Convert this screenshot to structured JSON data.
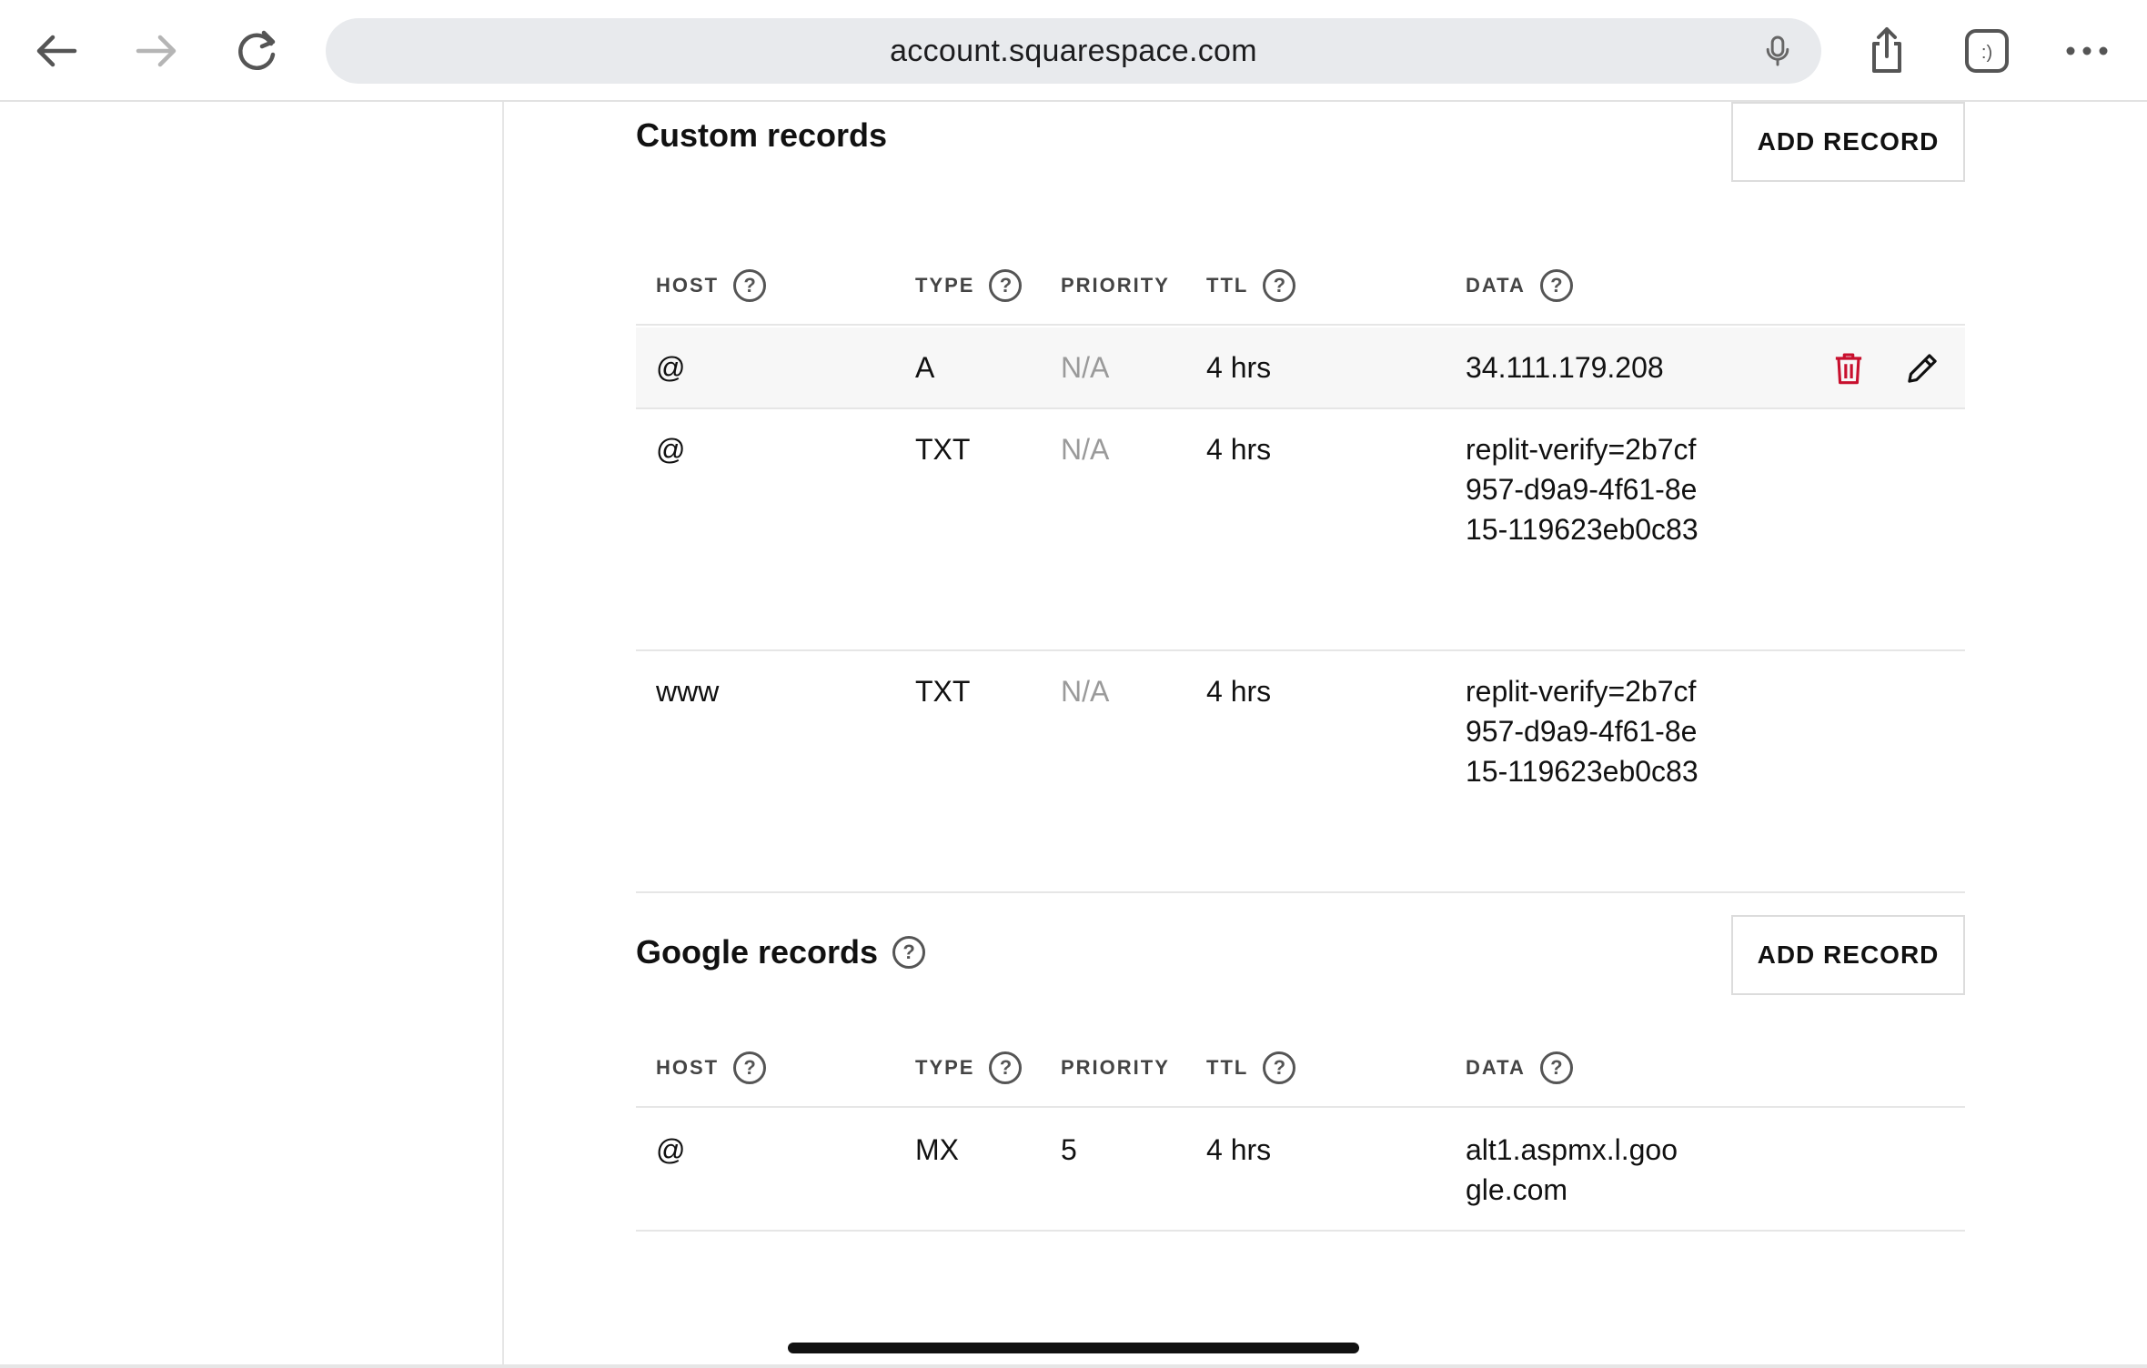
{
  "browser": {
    "url": "account.squarespace.com",
    "icons": {
      "back": "arrow-left-icon",
      "forward": "arrow-right-icon",
      "reload": "reload-icon",
      "mic": "microphone-icon",
      "share": "share-icon",
      "extension": "extension-icon",
      "more": "more-icon"
    },
    "extension_label": ":)"
  },
  "custom_records": {
    "title": "Custom records",
    "add_label": "ADD RECORD",
    "columns": {
      "host": "HOST",
      "type": "TYPE",
      "priority": "PRIORITY",
      "ttl": "TTL",
      "data": "DATA"
    },
    "rows": [
      {
        "host": "@",
        "type": "A",
        "priority": "N/A",
        "ttl": "4 hrs",
        "data": "34.111.179.208"
      },
      {
        "host": "@",
        "type": "TXT",
        "priority": "N/A",
        "ttl": "4 hrs",
        "data": "replit-verify=2b7cf957-d9a9-4f61-8e15-119623eb0c83"
      },
      {
        "host": "www",
        "type": "TXT",
        "priority": "N/A",
        "ttl": "4 hrs",
        "data": "replit-verify=2b7cf957-d9a9-4f61-8e15-119623eb0c83"
      }
    ]
  },
  "google_records": {
    "title": "Google records",
    "add_label": "ADD RECORD",
    "columns": {
      "host": "HOST",
      "type": "TYPE",
      "priority": "PRIORITY",
      "ttl": "TTL",
      "data": "DATA"
    },
    "rows": [
      {
        "host": "@",
        "type": "MX",
        "priority": "5",
        "ttl": "4 hrs",
        "data": "alt1.aspmx.l.google.com"
      }
    ]
  },
  "help_glyph": "?",
  "colors": {
    "delete": "#c8102e",
    "urlbar_bg": "#e8eaed",
    "divider": "#e6e6e6",
    "muted": "#9a9a9a"
  }
}
